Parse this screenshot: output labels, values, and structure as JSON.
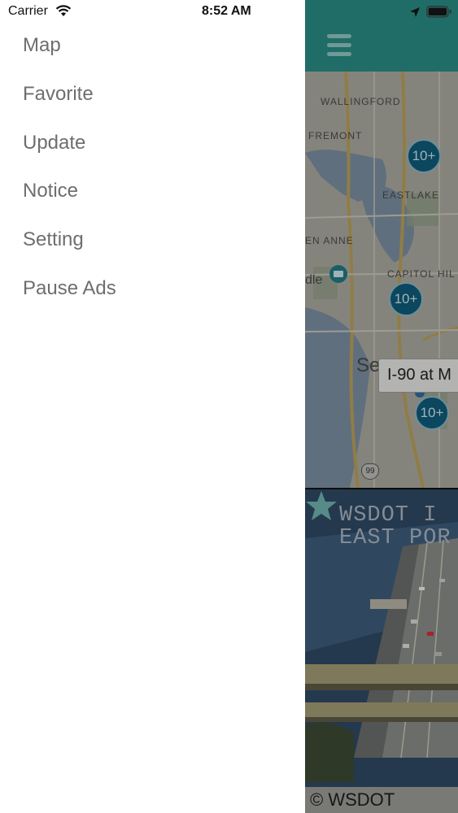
{
  "status_bar": {
    "carrier": "Carrier",
    "time": "8:52 AM",
    "icons": [
      "wifi-icon",
      "location-arrow-icon",
      "battery-icon"
    ]
  },
  "drawer": {
    "menu": [
      {
        "label": "Map"
      },
      {
        "label": "Favorite"
      },
      {
        "label": "Update"
      },
      {
        "label": "Notice"
      },
      {
        "label": "Setting"
      },
      {
        "label": "Pause Ads"
      }
    ]
  },
  "app": {
    "header_color": "#2a8c86",
    "header_icon": "hamburger-menu-icon",
    "map": {
      "labels": {
        "wallingford": "WALLINGFORD",
        "fremont": "FREMONT",
        "eastlake": "EASTLAKE",
        "queen_anne": "EN ANNE",
        "capitol_hill": "CAPITOL HIL",
        "park": "dle",
        "city": "Se"
      },
      "clusters": [
        "10+",
        "10+",
        "10+"
      ],
      "popup": "I-90 at M",
      "highway_shield": "99"
    },
    "camera": {
      "title": "WSDOT I\nEAST POR",
      "favorite_icon": "star-icon",
      "credit": "© WSDOT"
    }
  }
}
